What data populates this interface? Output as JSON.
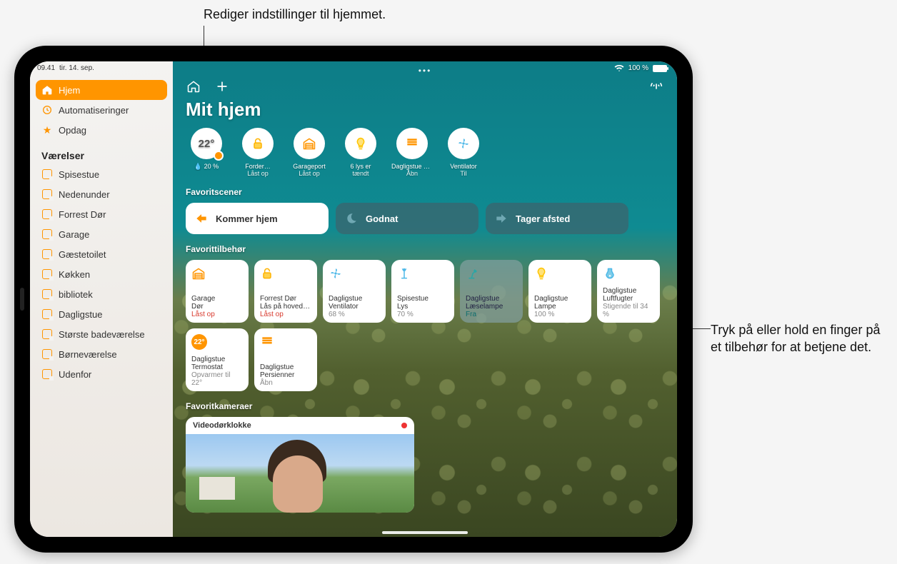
{
  "callouts": {
    "top": "Rediger indstillinger til hjemmet.",
    "right": "Tryk på eller hold en finger på et tilbehør for at betjene det."
  },
  "statusbar": {
    "time": "09.41",
    "date": "tir. 14. sep.",
    "battery_label": "100 %"
  },
  "sidebar": {
    "nav": [
      {
        "key": "home",
        "label": "Hjem",
        "active": true
      },
      {
        "key": "automations",
        "label": "Automatiseringer",
        "active": false
      },
      {
        "key": "discover",
        "label": "Opdag",
        "active": false
      }
    ],
    "rooms_heading": "Værelser",
    "rooms": [
      "Spisestue",
      "Nedenunder",
      "Forrest Dør",
      "Garage",
      "Gæstetoilet",
      "Køkken",
      "bibliotek",
      "Dagligstue",
      "Største badeværelse",
      "Børneværelse",
      "Udenfor"
    ]
  },
  "main": {
    "title": "Mit hjem",
    "climate": {
      "temp": "22°",
      "humidity": "20 %"
    },
    "categories": [
      {
        "label1": "Forder…",
        "label2": "Låst op",
        "icon": "lock"
      },
      {
        "label1": "Garageport",
        "label2": "Låst op",
        "icon": "garage"
      },
      {
        "label1": "6 lys er",
        "label2": "tændt",
        "icon": "bulb"
      },
      {
        "label1": "Dagligstue Persienner",
        "label2": "Åbn",
        "icon": "blinds"
      },
      {
        "label1": "Ventilator",
        "label2": "Til",
        "icon": "fan"
      }
    ],
    "scenes_heading": "Favoritscener",
    "scenes": [
      {
        "label": "Kommer hjem",
        "style": "light",
        "icon": "arrive"
      },
      {
        "label": "Godnat",
        "style": "dark",
        "icon": "moon"
      },
      {
        "label": "Tager afsted",
        "style": "dark",
        "icon": "leave"
      }
    ],
    "accessories_heading": "Favorittilbehør",
    "accessories": [
      {
        "room": "Garage",
        "name": "Dør",
        "status": "Låst op",
        "status_class": "status-red",
        "icon": "garage",
        "style": ""
      },
      {
        "room": "Forrest Dør",
        "name": "Lås på hoveddør",
        "status": "Låst op",
        "status_class": "status-red",
        "icon": "lock",
        "style": ""
      },
      {
        "room": "Dagligstue",
        "name": "Ventilator",
        "status": "68 %",
        "status_class": "status-gray",
        "icon": "fan",
        "style": ""
      },
      {
        "room": "Spisestue",
        "name": "Lys",
        "status": "70 %",
        "status_class": "status-gray",
        "icon": "floorlamp",
        "style": ""
      },
      {
        "room": "Dagligstue",
        "name": "Læselampe",
        "status": "Fra",
        "status_class": "status-teal",
        "icon": "desklamp",
        "style": "dim"
      },
      {
        "room": "Dagligstue",
        "name": "Lampe",
        "status": "100 %",
        "status_class": "status-gray",
        "icon": "bulb",
        "style": ""
      },
      {
        "room": "Dagligstue",
        "name": "Luftfugter",
        "status": "Stigende til 34 %",
        "status_class": "status-gray",
        "icon": "humidifier",
        "style": ""
      },
      {
        "room": "Dagligstue",
        "name": "Termostat",
        "status": "Opvarmer til 22°",
        "status_class": "status-gray",
        "icon": "thermostat",
        "style": ""
      },
      {
        "room": "Dagligstue",
        "name": "Persienner",
        "status": "Åbn",
        "status_class": "status-gray",
        "icon": "blinds",
        "style": ""
      }
    ],
    "cameras_heading": "Favoritkameraer",
    "camera_title": "Videodørklokke"
  }
}
